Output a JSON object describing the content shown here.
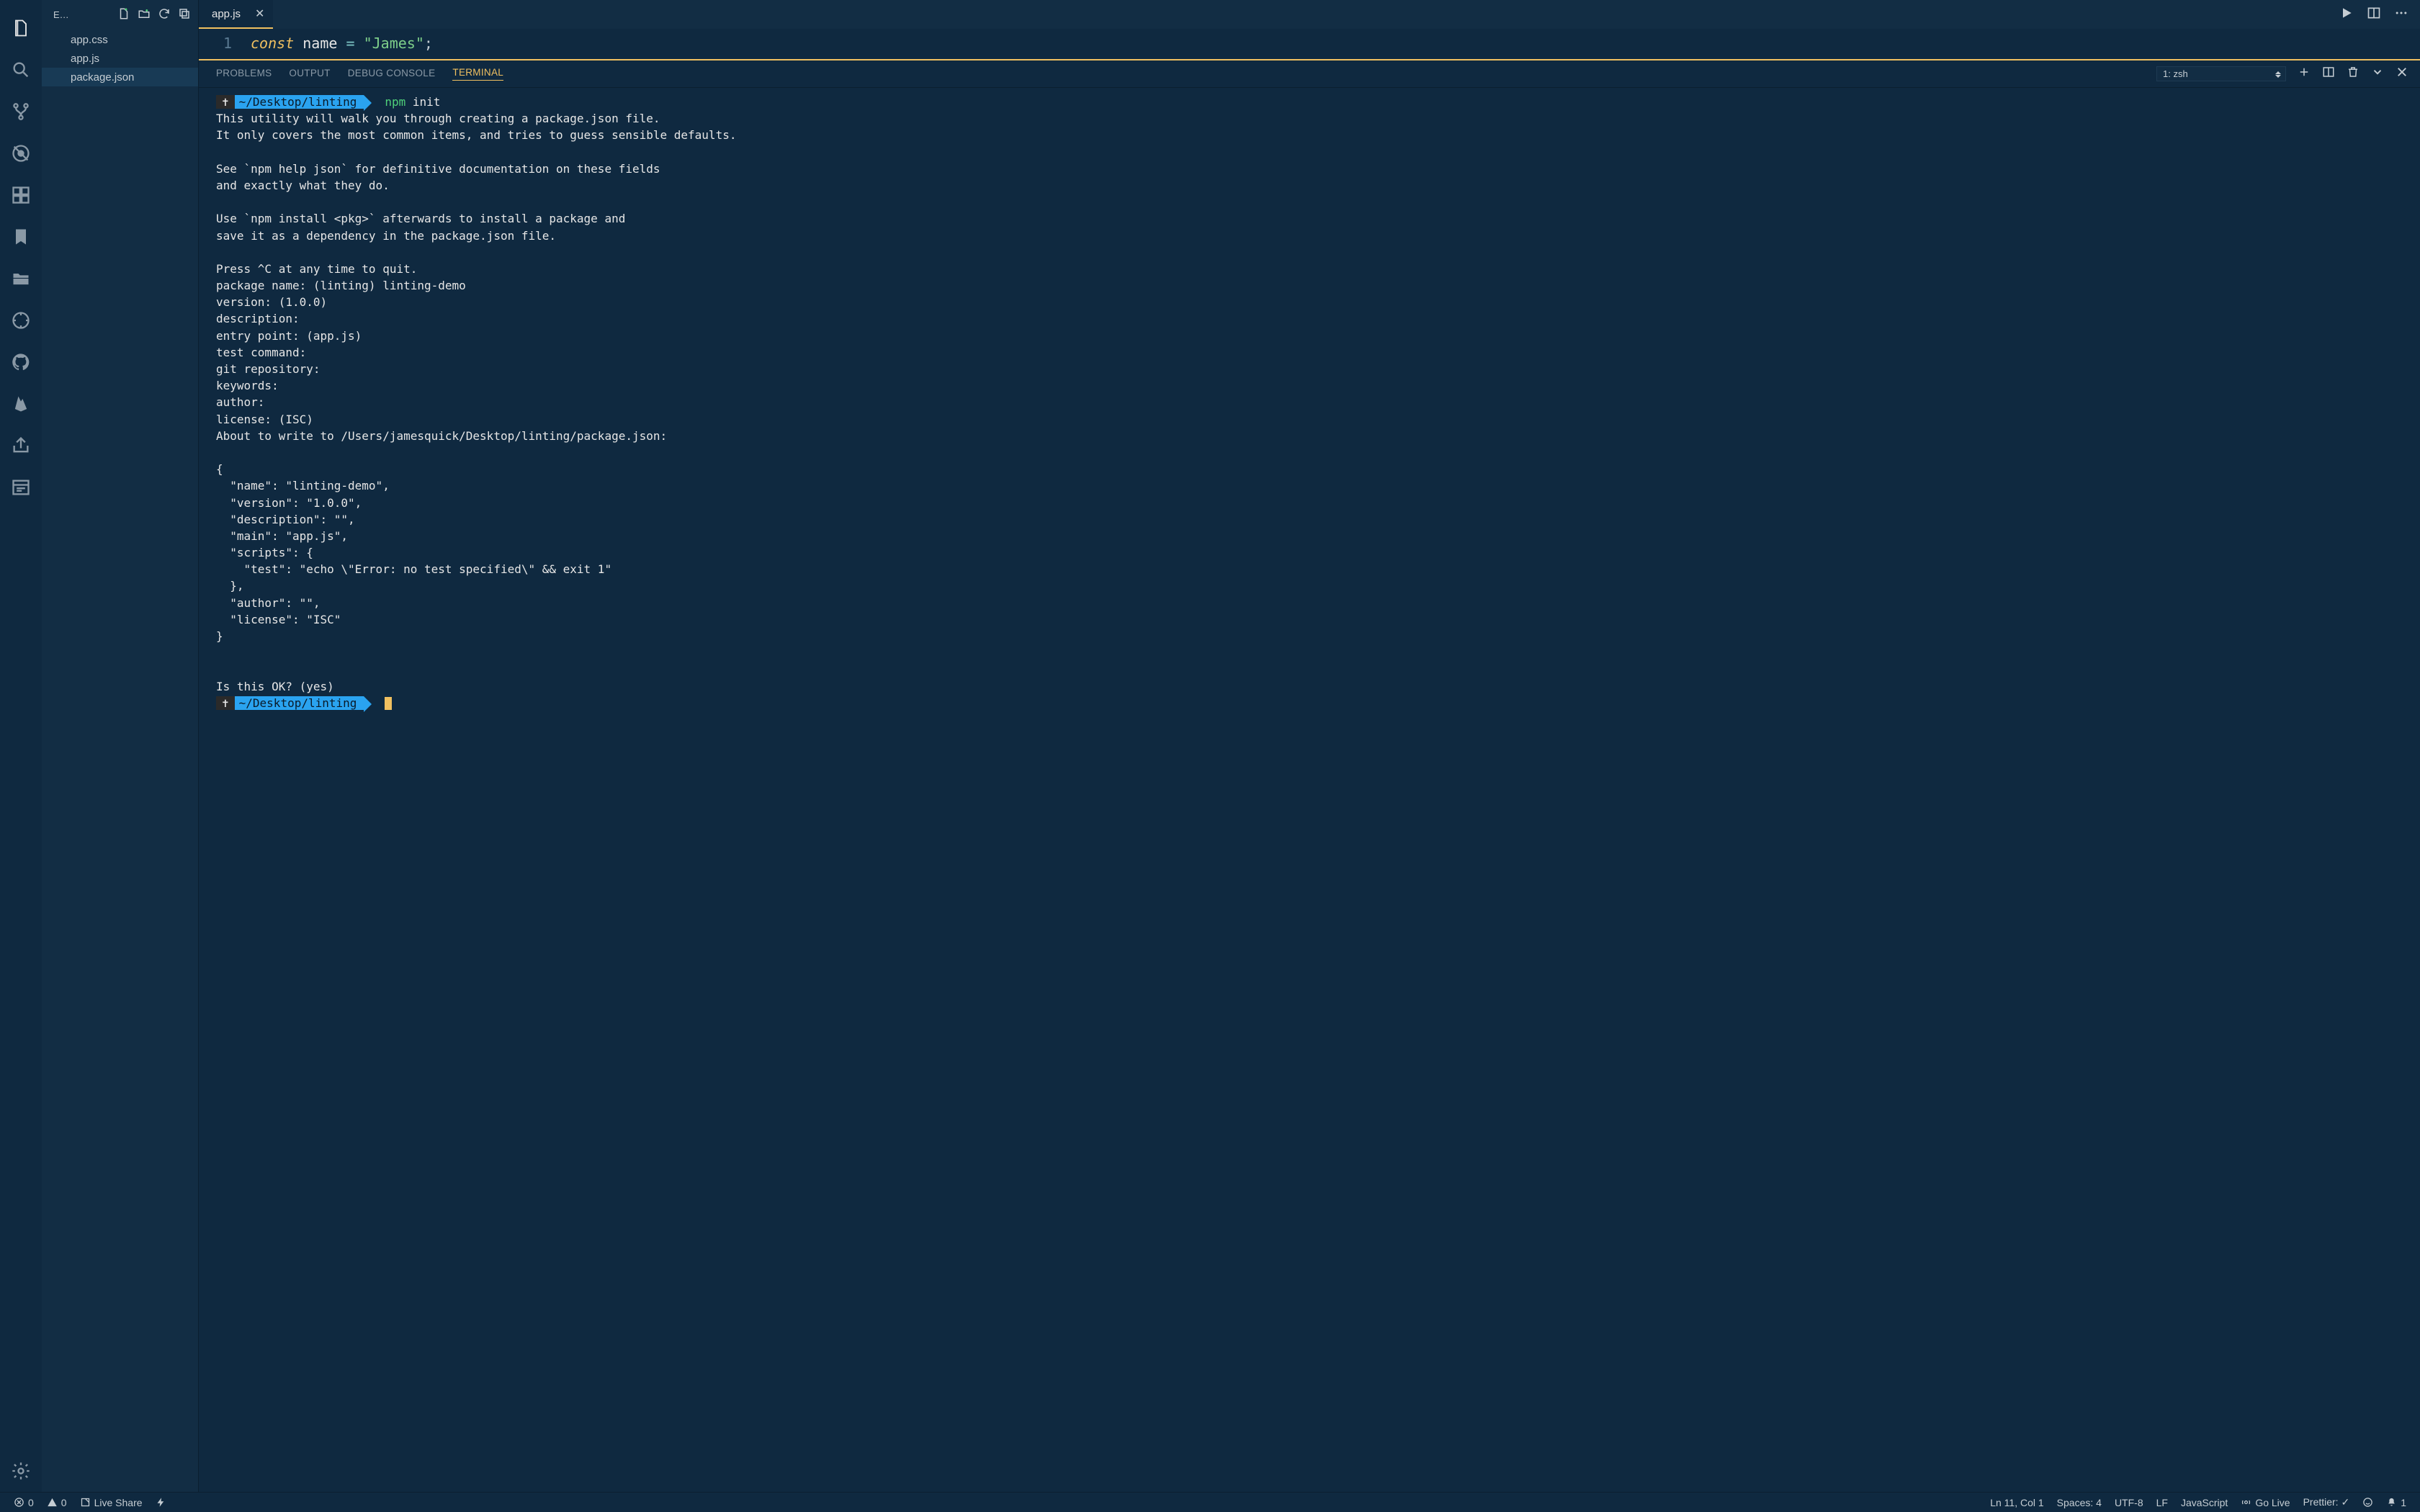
{
  "sidebar": {
    "header_label": "E…",
    "files": [
      "app.css",
      "app.js",
      "package.json"
    ],
    "selected_index": 2
  },
  "tabs": {
    "open": "app.js"
  },
  "editor": {
    "line_number": "1",
    "kw": "const",
    "ident": "name",
    "eq": "=",
    "string": "\"James\"",
    "semi": ";"
  },
  "panel": {
    "tabs": [
      "PROBLEMS",
      "OUTPUT",
      "DEBUG CONSOLE",
      "TERMINAL"
    ],
    "active_index": 3,
    "terminal_selector": "1: zsh"
  },
  "terminal": {
    "prompt_symbol": "✝",
    "prompt_path": "~/Desktop/linting",
    "cmd1_bin": "npm",
    "cmd1_args": "init",
    "body": "This utility will walk you through creating a package.json file.\nIt only covers the most common items, and tries to guess sensible defaults.\n\nSee `npm help json` for definitive documentation on these fields\nand exactly what they do.\n\nUse `npm install <pkg>` afterwards to install a package and\nsave it as a dependency in the package.json file.\n\nPress ^C at any time to quit.\npackage name: (linting) linting-demo\nversion: (1.0.0)\ndescription:\nentry point: (app.js)\ntest command:\ngit repository:\nkeywords:\nauthor:\nlicense: (ISC)\nAbout to write to /Users/jamesquick/Desktop/linting/package.json:\n\n{\n  \"name\": \"linting-demo\",\n  \"version\": \"1.0.0\",\n  \"description\": \"\",\n  \"main\": \"app.js\",\n  \"scripts\": {\n    \"test\": \"echo \\\"Error: no test specified\\\" && exit 1\"\n  },\n  \"author\": \"\",\n  \"license\": \"ISC\"\n}\n\n\nIs this OK? (yes)"
  },
  "status": {
    "errors": "0",
    "warnings": "0",
    "live_share": "Live Share",
    "ln_col": "Ln 11, Col 1",
    "spaces": "Spaces: 4",
    "encoding": "UTF-8",
    "eol": "LF",
    "language": "JavaScript",
    "go_live": "Go Live",
    "prettier": "Prettier: ✓",
    "bell": "1"
  }
}
